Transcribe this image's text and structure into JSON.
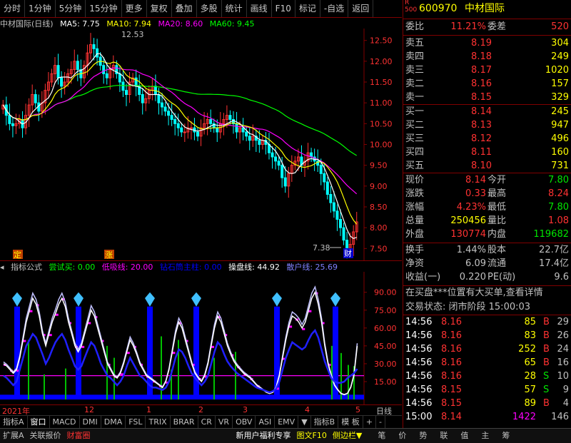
{
  "toolbar": [
    "分时",
    "1分钟",
    "5分钟",
    "15分钟",
    "更多",
    "复权",
    "叠加",
    "多股",
    "统计",
    "画线",
    "F10",
    "标记",
    "-自选",
    "返回"
  ],
  "header": {
    "title": "中材国际(日线)",
    "ma5": "MA5: 7.75",
    "ma10": "MA10: 7.94",
    "ma20": "MA20: 8.60",
    "ma60": "MA60: 9.45"
  },
  "colors": {
    "ma5": "#ffffff",
    "ma10": "#ffff00",
    "ma20": "#ff00ff",
    "ma60": "#00ff00",
    "up": "#ff3232",
    "down": "#00ffff",
    "buy": "#00ff00"
  },
  "main_annotations": {
    "high": "12.53",
    "low": "7.38",
    "cai": "财",
    "ding": "定",
    "zhang": "涨"
  },
  "sub_header": {
    "name": "指标公式",
    "try_buy": "尝试买: 0.00",
    "low_absorb": "低吸线: 20.00",
    "diamond": "钻石筒主柱: 0.00",
    "op_line": "操盘线: 44.92",
    "retail": "散户线: 25.69"
  },
  "x_labels": [
    "2021年",
    "12",
    "1",
    "2",
    "3",
    "4",
    "5"
  ],
  "x_right": "日线",
  "tabs": [
    "指标A",
    "窗口",
    "MACD",
    "DMI",
    "DMA",
    "FSL",
    "TRIX",
    "BRAR",
    "CR",
    "VR",
    "OBV",
    "ASI",
    "EMV",
    "▼",
    "指标B",
    "模 板",
    "+",
    "-"
  ],
  "bottom": [
    "扩展A",
    "关联报价",
    "财富圈",
    "新用户福利专享",
    "图文F10",
    "侧边栏▼",
    "笔",
    "价",
    "势",
    "联",
    "值",
    "主",
    "筹"
  ],
  "quote": {
    "code": "600970",
    "name": "中材国际",
    "r_label": "R",
    "r_num": "500",
    "weibi_label": "委比",
    "weibi": "11.21%",
    "weicha_label": "委差",
    "weicha": "520",
    "sells": [
      [
        "卖五",
        "8.19",
        "304"
      ],
      [
        "卖四",
        "8.18",
        "249"
      ],
      [
        "卖三",
        "8.17",
        "1020"
      ],
      [
        "卖二",
        "8.16",
        "157"
      ],
      [
        "卖一",
        "8.15",
        "329"
      ]
    ],
    "buys": [
      [
        "买一",
        "8.14",
        "245"
      ],
      [
        "买二",
        "8.13",
        "947"
      ],
      [
        "买三",
        "8.12",
        "496"
      ],
      [
        "买四",
        "8.11",
        "160"
      ],
      [
        "买五",
        "8.10",
        "731"
      ]
    ],
    "stats": [
      [
        "现价",
        "8.14",
        "今开",
        "7.80"
      ],
      [
        "涨跌",
        "0.33",
        "最高",
        "8.24"
      ],
      [
        "涨幅",
        "4.23%",
        "最低",
        "7.80"
      ],
      [
        "总量",
        "250456",
        "量比",
        "1.08"
      ],
      [
        "外盘",
        "130774",
        "内盘",
        "119682"
      ]
    ],
    "stats2": [
      [
        "换手",
        "1.44%",
        "股本",
        "22.7亿"
      ],
      [
        "净资",
        "6.09",
        "流通",
        "17.4亿"
      ],
      [
        "收益(一)",
        "0.220",
        "PE(动)",
        "9.6"
      ]
    ],
    "notice": "在买盘***位置有大买单,查看详情",
    "status": "交易状态: 闭市阶段 15:00:03",
    "ticks": [
      [
        "14:56",
        "8.16",
        "85",
        "B",
        "29"
      ],
      [
        "14:56",
        "8.16",
        "83",
        "B",
        "26"
      ],
      [
        "14:56",
        "8.16",
        "252",
        "B",
        "24"
      ],
      [
        "14:56",
        "8.16",
        "65",
        "B",
        "16"
      ],
      [
        "14:56",
        "8.16",
        "28",
        "S",
        "10"
      ],
      [
        "14:56",
        "8.15",
        "57",
        "S",
        "9"
      ],
      [
        "14:56",
        "8.15",
        "89",
        "B",
        "4"
      ],
      [
        "15:00",
        "8.14",
        "1422",
        "",
        "146"
      ]
    ]
  },
  "chart_data": {
    "type": "candlestick",
    "y_ticks": [
      12.5,
      12.0,
      11.5,
      11.0,
      10.5,
      10.0,
      9.5,
      9.0,
      8.5,
      8.0,
      7.5
    ],
    "ylim": [
      7.3,
      12.7
    ],
    "ma5_last": 7.75,
    "ma10_last": 7.94,
    "ma20_last": 8.6,
    "ma60_last": 9.45,
    "close": [
      10.95,
      10.7,
      10.5,
      10.45,
      10.5,
      10.6,
      10.4,
      10.7,
      10.95,
      11.2,
      11.0,
      10.8,
      11.0,
      11.3,
      11.5,
      11.7,
      11.9,
      11.6,
      11.4,
      11.5,
      11.7,
      11.8,
      12.0,
      11.8,
      11.6,
      11.9,
      12.2,
      12.4,
      12.3,
      12.1,
      11.9,
      11.7,
      11.6,
      11.8,
      11.9,
      11.7,
      11.5,
      11.3,
      11.2,
      11.5,
      11.6,
      11.4,
      11.2,
      11.0,
      11.1,
      11.3,
      11.4,
      11.2,
      11.0,
      10.9,
      10.8,
      10.7,
      10.6,
      10.5,
      10.4,
      10.3,
      10.3,
      10.4,
      10.4,
      10.3,
      10.2,
      10.4,
      10.5,
      10.6,
      10.5,
      10.4,
      10.3,
      10.5,
      10.6,
      10.7,
      10.6,
      10.5,
      10.3,
      10.4,
      10.3,
      10.2,
      10.1,
      10.2,
      10.1,
      10.0,
      10.1,
      10.0,
      9.8,
      9.7,
      9.6,
      9.5,
      9.2,
      9.0,
      9.3,
      9.5,
      9.6,
      9.7,
      9.5,
      9.6,
      9.8,
      9.7,
      9.6,
      9.5,
      9.3,
      9.1,
      8.8,
      8.6,
      8.4,
      8.2,
      8.0,
      7.7,
      7.5,
      7.6,
      7.9,
      8.14
    ],
    "sub_ylim": [
      0,
      100
    ],
    "sub_y_ticks": [
      90,
      75,
      60,
      45,
      30,
      15
    ],
    "low_absorb": 20,
    "op_line": [
      30,
      28,
      25,
      22,
      25,
      35,
      50,
      65,
      75,
      85,
      80,
      70,
      55,
      45,
      55,
      65,
      72,
      80,
      85,
      78,
      65,
      55,
      45,
      40,
      45,
      55,
      65,
      75,
      70,
      60,
      50,
      40,
      30,
      25,
      20,
      18,
      22,
      30,
      40,
      50,
      45,
      38,
      30,
      25,
      20,
      18,
      16,
      14,
      12,
      10,
      15,
      25,
      40,
      55,
      65,
      60,
      50,
      40,
      30,
      22,
      18,
      15,
      20,
      30,
      45,
      60,
      70,
      65,
      55,
      45,
      38,
      32,
      28,
      25,
      22,
      20,
      18,
      15,
      12,
      10,
      8,
      6,
      5,
      6,
      10,
      20,
      35,
      50,
      62,
      70,
      68,
      65,
      60,
      65,
      75,
      85,
      90,
      80,
      65,
      45,
      30,
      20,
      12,
      8,
      5,
      4,
      5,
      10,
      20,
      44.92
    ],
    "retail": [
      20,
      18,
      15,
      12,
      15,
      25,
      35,
      45,
      50,
      55,
      52,
      45,
      38,
      30,
      35,
      42,
      48,
      52,
      55,
      50,
      42,
      35,
      28,
      25,
      28,
      35,
      42,
      48,
      45,
      38,
      30,
      25,
      20,
      18,
      15,
      12,
      15,
      20,
      28,
      35,
      30,
      25,
      20,
      18,
      15,
      12,
      10,
      10,
      9,
      8,
      10,
      15,
      25,
      35,
      42,
      40,
      35,
      28,
      22,
      18,
      15,
      12,
      15,
      20,
      30,
      40,
      48,
      45,
      38,
      32,
      28,
      25,
      22,
      20,
      18,
      16,
      14,
      12,
      10,
      9,
      8,
      7,
      6,
      7,
      9,
      15,
      25,
      35,
      42,
      48,
      46,
      44,
      42,
      44,
      50,
      55,
      58,
      52,
      42,
      32,
      25,
      18,
      15,
      14,
      14,
      15,
      18,
      20,
      22,
      25.69
    ]
  }
}
